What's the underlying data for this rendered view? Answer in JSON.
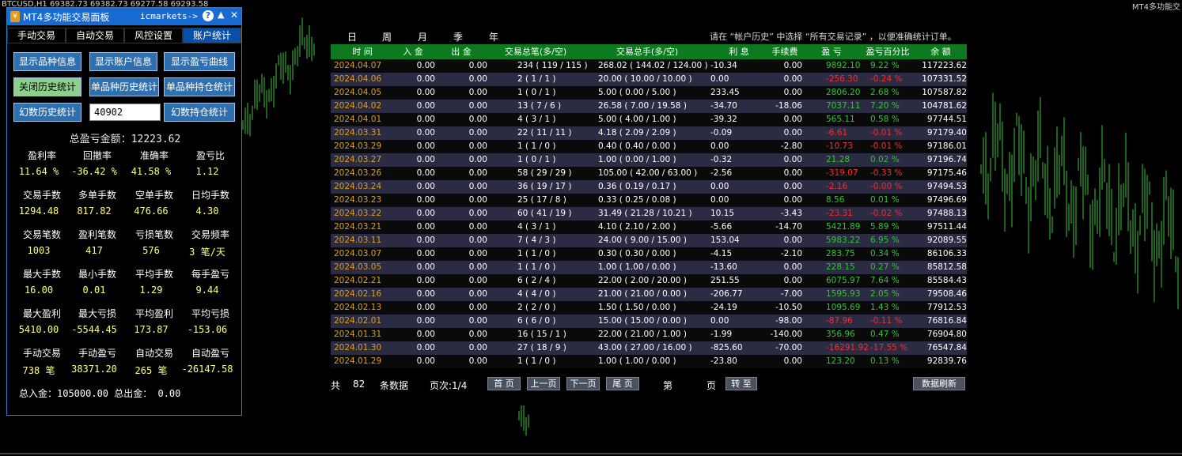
{
  "chart_header": {
    "symbol": "BTCUSD,H1",
    "ohlc": "69382.73 69382.73 69277.58 69293.58",
    "ea_name": "MT4多功能交"
  },
  "panel": {
    "title": "MT4多功能交易面板",
    "broker": "icmarkets->",
    "help": "?",
    "minimize": "▲",
    "close": "✕",
    "tabs": [
      "手动交易",
      "自动交易",
      "风控设置",
      "账户统计"
    ],
    "active_tab": 3,
    "buttons": {
      "show_symbol_info": "显示品种信息",
      "show_account_info": "显示账户信息",
      "show_pl_curve": "显示盈亏曲线",
      "close_history_stats": "关闭历史统计",
      "single_symbol_history": "单品种历史统计",
      "single_symbol_position": "单品种持仓统计",
      "magic_history": "幻数历史统计",
      "magic_position": "幻数持仓统计"
    },
    "magic_input_value": "40902",
    "total_pl_label": "总盈亏金额：",
    "total_pl_value": "12223.62",
    "stats": [
      [
        {
          "label": "盈利率",
          "value": "11.64 %"
        },
        {
          "label": "回撤率",
          "value": "-36.42 %"
        },
        {
          "label": "准确率",
          "value": "41.58 %"
        },
        {
          "label": "盈亏比",
          "value": "1.12"
        }
      ],
      [
        {
          "label": "交易手数",
          "value": "1294.48"
        },
        {
          "label": "多单手数",
          "value": "817.82"
        },
        {
          "label": "空单手数",
          "value": "476.66"
        },
        {
          "label": "日均手数",
          "value": "4.30"
        }
      ],
      [
        {
          "label": "交易笔数",
          "value": "1003"
        },
        {
          "label": "盈利笔数",
          "value": "417"
        },
        {
          "label": "亏损笔数",
          "value": "576"
        },
        {
          "label": "交易频率",
          "value": "3 笔/天"
        }
      ],
      [
        {
          "label": "最大手数",
          "value": "16.00"
        },
        {
          "label": "最小手数",
          "value": "0.01"
        },
        {
          "label": "平均手数",
          "value": "1.29"
        },
        {
          "label": "每手盈亏",
          "value": "9.44"
        }
      ],
      [
        {
          "label": "最大盈利",
          "value": "5410.00"
        },
        {
          "label": "最大亏损",
          "value": "-5544.45"
        },
        {
          "label": "平均盈利",
          "value": "173.87"
        },
        {
          "label": "平均亏损",
          "value": "-153.06"
        }
      ],
      [
        {
          "label": "手动交易",
          "value": "738 笔"
        },
        {
          "label": "手动盈亏",
          "value": "38371.20"
        },
        {
          "label": "自动交易",
          "value": "265 笔"
        },
        {
          "label": "自动盈亏",
          "value": "-26147.58"
        }
      ]
    ],
    "total_in_out": "总入金：105000.00 总出金： 0.00"
  },
  "periods": [
    "日",
    "周",
    "月",
    "季",
    "年"
  ],
  "hint": "请在 “帐户历史” 中选择 “所有交易记录” ，以便准确统计订单。",
  "table": {
    "headers": [
      "时 间",
      "入 金",
      "出 金",
      "交易总笔(多/空)",
      "交易总手(多/空)",
      "利 息",
      "手续费",
      "盈 亏",
      "盈亏百分比",
      "余 额"
    ],
    "rows": [
      [
        "2024.04.07",
        "0.00",
        "0.00",
        "234  ( 119 / 115 )",
        "268.02  ( 144.02 / 124.00 )",
        "-10.34",
        "0.00",
        "9892.10",
        "9.22 %",
        "117223.62"
      ],
      [
        "2024.04.06",
        "0.00",
        "0.00",
        "2  ( 1 / 1 )",
        "20.00  ( 10.00 / 10.00 )",
        "0.00",
        "0.00",
        "-256.30",
        "-0.24 %",
        "107331.52"
      ],
      [
        "2024.04.05",
        "0.00",
        "0.00",
        "1  ( 0 / 1 )",
        "5.00  ( 0.00 / 5.00 )",
        "233.45",
        "0.00",
        "2806.20",
        "2.68 %",
        "107587.82"
      ],
      [
        "2024.04.02",
        "0.00",
        "0.00",
        "13  ( 7 / 6 )",
        "26.58  ( 7.00 / 19.58 )",
        "-34.70",
        "-18.06",
        "7037.11",
        "7.20 %",
        "104781.62"
      ],
      [
        "2024.04.01",
        "0.00",
        "0.00",
        "4  ( 3 / 1 )",
        "5.00  ( 4.00 / 1.00 )",
        "-39.32",
        "0.00",
        "565.11",
        "0.58 %",
        "97744.51"
      ],
      [
        "2024.03.31",
        "0.00",
        "0.00",
        "22  ( 11 / 11 )",
        "4.18  ( 2.09 / 2.09 )",
        "-0.09",
        "0.00",
        "-6.61",
        "-0.01 %",
        "97179.40"
      ],
      [
        "2024.03.29",
        "0.00",
        "0.00",
        "1  ( 1 / 0 )",
        "0.40  ( 0.40 / 0.00 )",
        "0.00",
        "-2.80",
        "-10.73",
        "-0.01 %",
        "97186.01"
      ],
      [
        "2024.03.27",
        "0.00",
        "0.00",
        "1  ( 0 / 1 )",
        "1.00  ( 0.00 / 1.00 )",
        "-0.32",
        "0.00",
        "21.28",
        "0.02 %",
        "97196.74"
      ],
      [
        "2024.03.26",
        "0.00",
        "0.00",
        "58  ( 29 / 29 )",
        "105.00  ( 42.00 / 63.00 )",
        "-2.56",
        "0.00",
        "-319.07",
        "-0.33 %",
        "97175.46"
      ],
      [
        "2024.03.24",
        "0.00",
        "0.00",
        "36  ( 19 / 17 )",
        "0.36  ( 0.19 / 0.17 )",
        "0.00",
        "0.00",
        "-2.16",
        "-0.00 %",
        "97494.53"
      ],
      [
        "2024.03.23",
        "0.00",
        "0.00",
        "25  ( 17 / 8 )",
        "0.33  ( 0.25 / 0.08 )",
        "0.00",
        "0.00",
        "8.56",
        "0.01 %",
        "97496.69"
      ],
      [
        "2024.03.22",
        "0.00",
        "0.00",
        "60  ( 41 / 19 )",
        "31.49  ( 21.28 / 10.21 )",
        "10.15",
        "-3.43",
        "-23.31",
        "-0.02 %",
        "97488.13"
      ],
      [
        "2024.03.21",
        "0.00",
        "0.00",
        "4  ( 3 / 1 )",
        "4.10  ( 2.10 / 2.00 )",
        "-5.66",
        "-14.70",
        "5421.89",
        "5.89 %",
        "97511.44"
      ],
      [
        "2024.03.11",
        "0.00",
        "0.00",
        "7  ( 4 / 3 )",
        "24.00  ( 9.00 / 15.00 )",
        "153.04",
        "0.00",
        "5983.22",
        "6.95 %",
        "92089.55"
      ],
      [
        "2024.03.07",
        "0.00",
        "0.00",
        "1  ( 1 / 0 )",
        "0.30  ( 0.30 / 0.00 )",
        "-4.15",
        "-2.10",
        "283.75",
        "0.34 %",
        "86106.33"
      ],
      [
        "2024.03.05",
        "0.00",
        "0.00",
        "1  ( 1 / 0 )",
        "1.00  ( 1.00 / 0.00 )",
        "-13.60",
        "0.00",
        "228.15",
        "0.27 %",
        "85812.58"
      ],
      [
        "2024.02.21",
        "0.00",
        "0.00",
        "6  ( 2 / 4 )",
        "22.00  ( 2.00 / 20.00 )",
        "251.55",
        "0.00",
        "6075.97",
        "7.64 %",
        "85584.43"
      ],
      [
        "2024.02.16",
        "0.00",
        "0.00",
        "4  ( 4 / 0 )",
        "21.00  ( 21.00 / 0.00 )",
        "-206.77",
        "-7.00",
        "1595.93",
        "2.05 %",
        "79508.46"
      ],
      [
        "2024.02.13",
        "0.00",
        "0.00",
        "2  ( 2 / 0 )",
        "1.50  ( 1.50 / 0.00 )",
        "-24.19",
        "-10.50",
        "1095.69",
        "1.43 %",
        "77912.53"
      ],
      [
        "2024.02.01",
        "0.00",
        "0.00",
        "6  ( 6 / 0 )",
        "15.00  ( 15.00 / 0.00 )",
        "0.00",
        "-98.00",
        "-87.96",
        "-0.11 %",
        "76816.84"
      ],
      [
        "2024.01.31",
        "0.00",
        "0.00",
        "16  ( 15 / 1 )",
        "22.00  ( 21.00 / 1.00 )",
        "-1.99",
        "-140.00",
        "356.96",
        "0.47 %",
        "76904.80"
      ],
      [
        "2024.01.30",
        "0.00",
        "0.00",
        "27  ( 18 / 9 )",
        "43.00  ( 27.00 / 16.00 )",
        "-825.60",
        "-70.00",
        "-16291.92",
        "-17.55 %",
        "76547.84"
      ],
      [
        "2024.01.29",
        "0.00",
        "0.00",
        "1  ( 1 / 0 )",
        "1.00  ( 1.00 / 0.00 )",
        "-23.80",
        "0.00",
        "123.20",
        "0.13 %",
        "92839.76"
      ]
    ]
  },
  "footer": {
    "total_prefix": "共",
    "total_count": "82",
    "total_suffix": "条数据",
    "page_label": "页次:1/4",
    "first_page": "首 页",
    "prev_page": "上一页",
    "next_page": "下一页",
    "last_page": "尾 页",
    "goto_prefix": "第",
    "goto_suffix": "页",
    "goto_button": "转 至",
    "refresh_button": "数据刷新"
  },
  "colors": {
    "profit": "#2ec82e",
    "loss": "#ff2a2a",
    "date": "#d8a020",
    "header_green": "#0d7a20",
    "panel_blue": "#1a6bd1"
  }
}
